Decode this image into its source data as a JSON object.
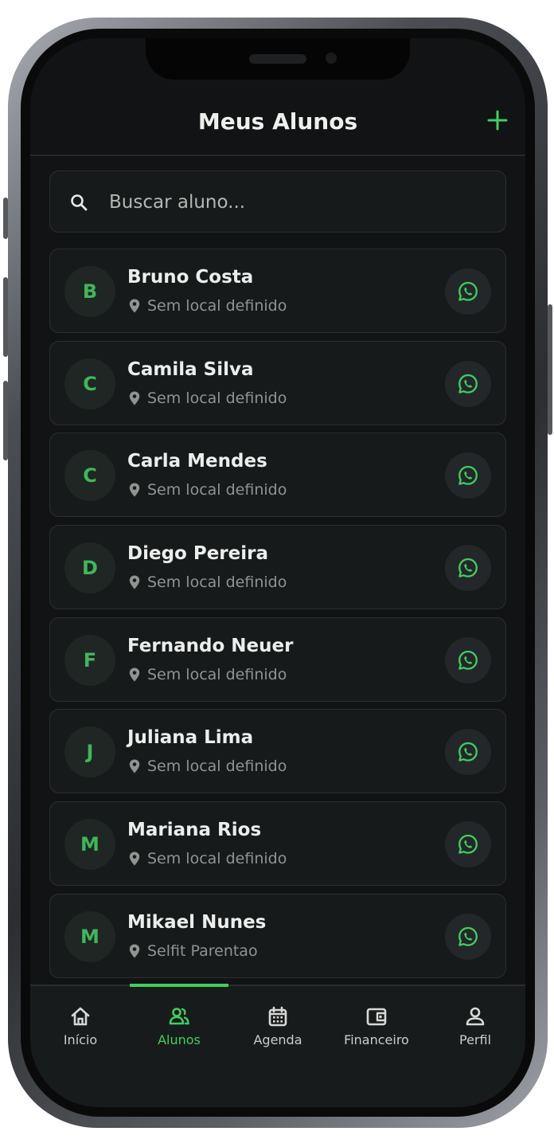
{
  "header": {
    "title": "Meus Alunos",
    "add_icon": "plus-icon"
  },
  "search": {
    "placeholder": "Buscar aluno...",
    "value": ""
  },
  "students": [
    {
      "initial": "B",
      "name": "Bruno Costa",
      "location": "Sem local definido"
    },
    {
      "initial": "C",
      "name": "Camila Silva",
      "location": "Sem local definido"
    },
    {
      "initial": "C",
      "name": "Carla Mendes",
      "location": "Sem local definido"
    },
    {
      "initial": "D",
      "name": "Diego Pereira",
      "location": "Sem local definido"
    },
    {
      "initial": "F",
      "name": "Fernando Neuer",
      "location": "Sem local definido"
    },
    {
      "initial": "J",
      "name": "Juliana Lima",
      "location": "Sem local definido"
    },
    {
      "initial": "M",
      "name": "Mariana Rios",
      "location": "Sem local definido"
    },
    {
      "initial": "M",
      "name": "Mikael Nunes",
      "location": "Selfit Parentao"
    }
  ],
  "nav": {
    "active": "Alunos",
    "items": [
      {
        "label": "Início",
        "icon": "home-icon"
      },
      {
        "label": "Alunos",
        "icon": "users-icon"
      },
      {
        "label": "Agenda",
        "icon": "calendar-icon"
      },
      {
        "label": "Financeiro",
        "icon": "wallet-icon"
      },
      {
        "label": "Perfil",
        "icon": "person-icon"
      }
    ]
  },
  "colors": {
    "accent": "#3fcf5f",
    "background": "#111314",
    "card": "#171a1b",
    "text_primary": "#eceeec",
    "text_secondary": "#8e9490"
  }
}
